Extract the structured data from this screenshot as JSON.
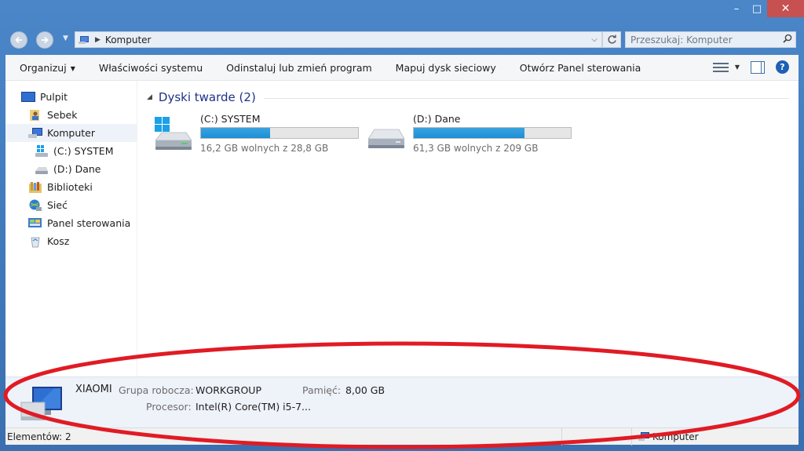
{
  "window": {
    "minimize_glyph": "–",
    "maximize_glyph": "□",
    "close_glyph": "✕"
  },
  "address_bar": {
    "path": "Komputer",
    "search_placeholder": "Przeszukaj: Komputer"
  },
  "toolbar": {
    "items": [
      {
        "label": "Organizuj",
        "has_caret": true
      },
      {
        "label": "Właściwości systemu"
      },
      {
        "label": "Odinstaluj lub zmień program"
      },
      {
        "label": "Mapuj dysk sieciowy"
      },
      {
        "label": "Otwórz Panel sterowania"
      }
    ]
  },
  "sidebar": {
    "items": [
      {
        "label": "Pulpit",
        "icon": "desktop-icon"
      },
      {
        "label": "Sebek",
        "icon": "user-folder-icon"
      },
      {
        "label": "Komputer",
        "icon": "computer-icon",
        "selected": true
      },
      {
        "label": "(C:) SYSTEM",
        "icon": "system-drive-icon"
      },
      {
        "label": "(D:) Dane",
        "icon": "drive-icon"
      },
      {
        "label": "Biblioteki",
        "icon": "libraries-icon"
      },
      {
        "label": "Sieć",
        "icon": "network-icon"
      },
      {
        "label": "Panel sterowania",
        "icon": "control-panel-icon"
      },
      {
        "label": "Kosz",
        "icon": "recycle-bin-icon"
      }
    ]
  },
  "content": {
    "group_title": "Dyski twarde (2)",
    "drives": [
      {
        "name": "(C:) SYSTEM",
        "free_text": "16,2 GB wolnych z 28,8 GB",
        "used_fraction": 0.4375,
        "icon": "system-drive-icon"
      },
      {
        "name": "(D:) Dane",
        "free_text": "61,3 GB wolnych z 209 GB",
        "used_fraction": 0.707,
        "icon": "drive-icon"
      }
    ]
  },
  "details": {
    "computer_name": "XIAOMI",
    "workgroup_label": "Grupa robocza:",
    "workgroup_value": "WORKGROUP",
    "memory_label": "Pamięć:",
    "memory_value": "8,00 GB",
    "processor_label": "Procesor:",
    "processor_value": "Intel(R) Core(TM) i5-7..."
  },
  "status_bar": {
    "item_count": "Elementów: 2",
    "location": "Komputer"
  },
  "colors": {
    "window_frame": "#3f76b8",
    "close_button": "#c75050",
    "usage_bar": "#1c8fd6",
    "group_header": "#1e3287",
    "annotation_ellipse": "#e01b24"
  }
}
